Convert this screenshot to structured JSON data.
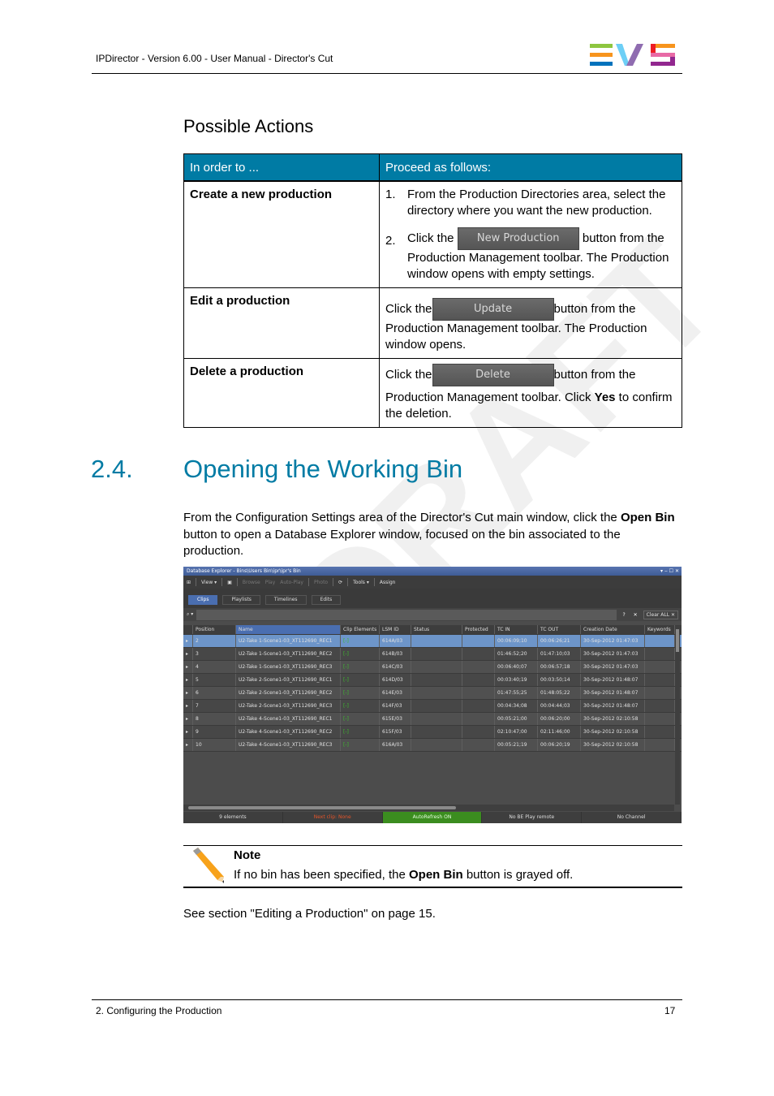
{
  "header": {
    "title": "IPDirector - Version 6.00 - User Manual - Director's Cut",
    "logo": "EVS",
    "logo_colors": {
      "green": "#8dc63f",
      "orange": "#f7941d",
      "blue": "#0072bc",
      "lightblue": "#6dcff6",
      "purple": "#8f6cb0",
      "red": "#ed1c24",
      "pink": "#e86aa6",
      "violet": "#92278f"
    }
  },
  "watermark": "DRAFT",
  "possible_actions": {
    "heading": "Possible Actions",
    "col1_header": "In order to ...",
    "col2_header": "Proceed as follows:",
    "header_color": "#007ba4",
    "rows": [
      {
        "action": "Create a new production",
        "steps": [
          {
            "num": "1.",
            "text": "From the Production Directories area, select the directory where you want the new production."
          },
          {
            "num": "2.",
            "pre": "Click the",
            "button": "New Production",
            "post": "button from the Production Management toolbar. The Production window opens with empty settings."
          }
        ]
      },
      {
        "action": "Edit a production",
        "pre": "Click the",
        "button": "Update",
        "post": "button from the Production Management toolbar. The Production window opens."
      },
      {
        "action": "Delete a production",
        "pre": "Click the",
        "button": "Delete",
        "post1": "button from the",
        "post2a": "Production Management toolbar. Click ",
        "post2b": "Yes",
        "post2c": " to confirm the deletion."
      }
    ]
  },
  "section": {
    "number": "2.4.",
    "title": "Opening the Working Bin",
    "color": "#007ba4",
    "para_a": "From the Configuration Settings area of the Director's Cut main window, click the ",
    "para_b": "Open Bin",
    "para_c": " button to open a Database Explorer window, focused on the bin associated to the production."
  },
  "db_explorer": {
    "title": "Database Explorer - Bins\\Users Bin\\ipr\\ipr's Bin",
    "window_controls": "▾ ‒ ☐ ✕",
    "toolbar": [
      "View ▾",
      "Browse",
      "Play",
      "Auto-Play",
      "Photo",
      "Tools ▾",
      "Assign"
    ],
    "tabs": [
      {
        "label": "Clips",
        "active": true
      },
      {
        "label": "Playlists",
        "active": false
      },
      {
        "label": "Timelines",
        "active": false
      },
      {
        "label": "Edits",
        "active": false
      }
    ],
    "search_help": "?",
    "search_clear": "✕",
    "clear_all": "Clear ALL ✕",
    "columns": [
      "Position",
      "Name",
      "Clip Elements",
      "LSM ID",
      "Status",
      "Protected",
      "TC IN",
      "TC OUT",
      "Creation Date",
      "Keywords"
    ],
    "sorted_column": "Name",
    "rows": [
      {
        "pos": "2",
        "name": "U2-Take 1-Scene1-03_XT112690_REC1",
        "ce": "[-]",
        "lsm": "614A/03",
        "status": "",
        "prot": "",
        "tcin": "00:06:09;10",
        "tcout": "00:06:26;21",
        "date": "30-Sep-2012 01:47:03",
        "kw": "",
        "selected": true
      },
      {
        "pos": "3",
        "name": "U2-Take 1-Scene1-03_XT112690_REC2",
        "ce": "[-]",
        "lsm": "614B/03",
        "status": "",
        "prot": "",
        "tcin": "01:46:52;20",
        "tcout": "01:47:10;03",
        "date": "30-Sep-2012 01:47:03",
        "kw": ""
      },
      {
        "pos": "4",
        "name": "U2-Take 1-Scene1-03_XT112690_REC3",
        "ce": "[-]",
        "lsm": "614C/03",
        "status": "",
        "prot": "",
        "tcin": "00:06:40;07",
        "tcout": "00:06:57;18",
        "date": "30-Sep-2012 01:47:03",
        "kw": ""
      },
      {
        "pos": "5",
        "name": "U2-Take 2-Scene1-03_XT112690_REC1",
        "ce": "[-]",
        "lsm": "614D/03",
        "status": "",
        "prot": "",
        "tcin": "00:03:40;19",
        "tcout": "00:03:50;14",
        "date": "30-Sep-2012 01:48:07",
        "kw": ""
      },
      {
        "pos": "6",
        "name": "U2-Take 2-Scene1-03_XT112690_REC2",
        "ce": "[-]",
        "lsm": "614E/03",
        "status": "",
        "prot": "",
        "tcin": "01:47:55;25",
        "tcout": "01:48:05;22",
        "date": "30-Sep-2012 01:48:07",
        "kw": ""
      },
      {
        "pos": "7",
        "name": "U2-Take 2-Scene1-03_XT112690_REC3",
        "ce": "[-]",
        "lsm": "614F/03",
        "status": "",
        "prot": "",
        "tcin": "00:04:34;08",
        "tcout": "00:04:44;03",
        "date": "30-Sep-2012 01:48:07",
        "kw": ""
      },
      {
        "pos": "8",
        "name": "U2-Take 4-Scene1-03_XT112690_REC1",
        "ce": "[-]",
        "lsm": "615E/03",
        "status": "",
        "prot": "",
        "tcin": "00:05:21;00",
        "tcout": "00:06:20;00",
        "date": "30-Sep-2012 02:10:58",
        "kw": ""
      },
      {
        "pos": "9",
        "name": "U2-Take 4-Scene1-03_XT112690_REC2",
        "ce": "[-]",
        "lsm": "615F/03",
        "status": "",
        "prot": "",
        "tcin": "02:10:47;00",
        "tcout": "02:11:46;00",
        "date": "30-Sep-2012 02:10:58",
        "kw": ""
      },
      {
        "pos": "10",
        "name": "U2-Take 4-Scene1-03_XT112690_REC3",
        "ce": "[-]",
        "lsm": "616A/03",
        "status": "",
        "prot": "",
        "tcin": "00:05:21;19",
        "tcout": "00:06:20;19",
        "date": "30-Sep-2012 02:10:58",
        "kw": ""
      }
    ],
    "status_bar": [
      "9 elements",
      "Next clip: None",
      "AutoRefresh ON",
      "No BE Play remote",
      "No Channel"
    ]
  },
  "note": {
    "title": "Note",
    "text_a": "If no bin has been specified, the ",
    "text_b": "Open Bin",
    "text_c": " button is grayed off."
  },
  "see_also": "See section \"Editing a Production\" on page 15.",
  "footer": {
    "left": "2. Configuring the Production",
    "page": "17"
  }
}
